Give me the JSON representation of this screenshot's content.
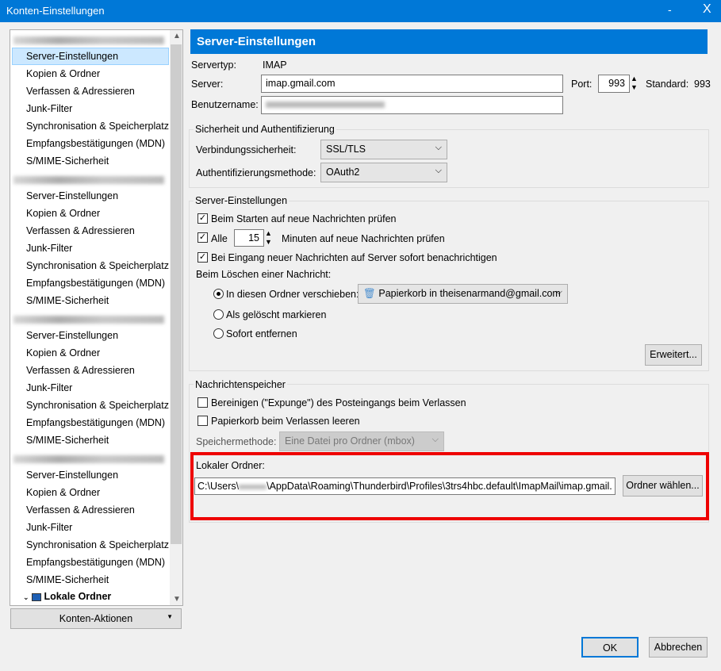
{
  "window": {
    "title": "Konten-Einstellungen",
    "minimize": "-",
    "close": "X"
  },
  "sidebar": {
    "accounts": [
      {
        "items": [
          "Server-Einstellungen",
          "Kopien & Ordner",
          "Verfassen & Adressieren",
          "Junk-Filter",
          "Synchronisation & Speicherplatz",
          "Empfangsbestätigungen (MDN)",
          "S/MIME-Sicherheit"
        ]
      },
      {
        "items": [
          "Server-Einstellungen",
          "Kopien & Ordner",
          "Verfassen & Adressieren",
          "Junk-Filter",
          "Synchronisation & Speicherplatz",
          "Empfangsbestätigungen (MDN)",
          "S/MIME-Sicherheit"
        ]
      },
      {
        "items": [
          "Server-Einstellungen",
          "Kopien & Ordner",
          "Verfassen & Adressieren",
          "Junk-Filter",
          "Synchronisation & Speicherplatz",
          "Empfangsbestätigungen (MDN)",
          "S/MIME-Sicherheit"
        ]
      },
      {
        "items": [
          "Server-Einstellungen",
          "Kopien & Ordner",
          "Verfassen & Adressieren",
          "Junk-Filter",
          "Synchronisation & Speicherplatz",
          "Empfangsbestätigungen (MDN)",
          "S/MIME-Sicherheit"
        ]
      }
    ],
    "local_folders": "Lokale Ordner",
    "actions_button": "Konten-Aktionen"
  },
  "main": {
    "title": "Server-Einstellungen",
    "servertype_label": "Servertyp:",
    "servertype": "IMAP",
    "server_label": "Server:",
    "server": "imap.gmail.com",
    "port_label": "Port:",
    "port": "993",
    "standard_label": "Standard:",
    "standard": "993",
    "username_label": "Benutzername:",
    "security": {
      "legend": "Sicherheit und Authentifizierung",
      "conn_label": "Verbindungssicherheit:",
      "conn": "SSL/TLS",
      "auth_label": "Authentifizierungsmethode:",
      "auth": "OAuth2"
    },
    "server_settings": {
      "legend": "Server-Einstellungen",
      "check_start": "Beim Starten auf neue Nachrichten prüfen",
      "every": "Alle",
      "minutes": "15",
      "minutes_label": "Minuten auf neue Nachrichten prüfen",
      "notify": "Bei Eingang neuer Nachrichten auf Server sofort benachrichtigen",
      "delete_label": "Beim Löschen einer Nachricht:",
      "move_to": "In diesen Ordner verschieben:",
      "trash_folder": "Papierkorb in theisenarmand@gmail.com",
      "mark_deleted": "Als gelöscht markieren",
      "delete_now": "Sofort entfernen",
      "advanced": "Erweitert..."
    },
    "storage": {
      "legend": "Nachrichtenspeicher",
      "expunge": "Bereinigen (\"Expunge\") des Posteingangs beim Verlassen",
      "empty_trash": "Papierkorb beim Verlassen leeren",
      "method_label": "Speichermethode:",
      "method": "Eine Datei pro Ordner (mbox)",
      "local_label": "Lokaler Ordner:",
      "path_prefix": "C:\\Users\\",
      "path_suffix": "\\AppData\\Roaming\\Thunderbird\\Profiles\\3trs4hbc.default\\ImapMail\\imap.gmail.",
      "choose": "Ordner wählen..."
    }
  },
  "footer": {
    "ok": "OK",
    "cancel": "Abbrechen"
  },
  "colors": {
    "accent": "#0078d7",
    "highlight": "#ff0000",
    "selection": "#cce8ff"
  }
}
